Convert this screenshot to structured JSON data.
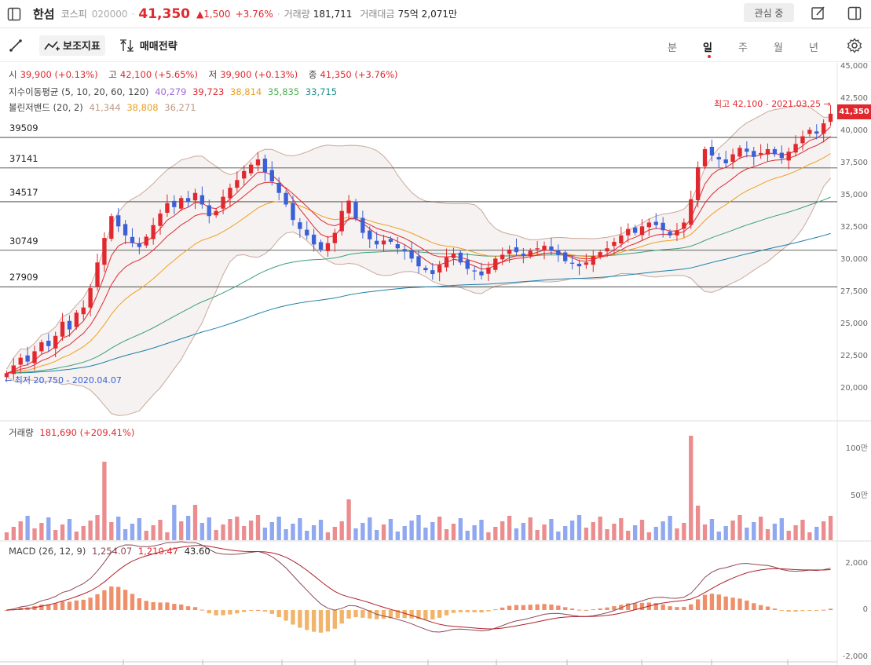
{
  "header": {
    "stock_name": "한섬",
    "market": "코스피",
    "code": "020000",
    "price": "41,350",
    "change": "▲1,500",
    "change_pct": "+3.76%",
    "volume_label": "거래량",
    "volume": "181,711",
    "amount_label": "거래대금",
    "amount": "75억 2,071만",
    "watch_label": "관심 중"
  },
  "toolbar": {
    "indicator_label": "보조지표",
    "strategy_label": "매매전략",
    "periods": [
      "분",
      "일",
      "주",
      "월",
      "년"
    ],
    "active_period": "일"
  },
  "legend": {
    "ohlc": {
      "open_label": "시",
      "open": "39,900 (+0.13%)",
      "high_label": "고",
      "high": "42,100 (+5.65%)",
      "low_label": "저",
      "low": "39,900 (+0.13%)",
      "close_label": "종",
      "close": "41,350 (+3.76%)"
    },
    "ema": {
      "label": "지수이동평균 (5, 10, 20, 60, 120)",
      "values": [
        "40,279",
        "39,723",
        "38,814",
        "35,835",
        "33,715"
      ]
    },
    "bollinger": {
      "label": "볼린저밴드 (20, 2)",
      "values": [
        "41,344",
        "38,808",
        "36,271"
      ]
    }
  },
  "horizontal_lines": [
    "39509",
    "37141",
    "34517",
    "30749",
    "27909"
  ],
  "annotations": {
    "high": "최고 42,100 - 2021.03.25 →",
    "low": "← 최저 20,750 - 2020.04.07",
    "current_price_tag": "41,350"
  },
  "volume_panel": {
    "label": "거래량",
    "value": "181,690 (+209.41%)",
    "axis": [
      "100만",
      "50만"
    ]
  },
  "macd_panel": {
    "label": "MACD (26, 12, 9)",
    "values": [
      "1,254.07",
      "1,210.47",
      "43.60"
    ],
    "axis": [
      "2,000",
      "0",
      "-2,000"
    ]
  },
  "colors": {
    "up": "#e0282e",
    "down": "#3b5fd6",
    "ema5": "#e0282e",
    "ema10": "#f0a020",
    "ema20": "#4caf50",
    "ema60": "#3aa07a",
    "ema120": "#1e7ea8",
    "bollinger_band": "#c9a99a"
  },
  "chart_data": {
    "type": "candlestick",
    "price_axis": [
      "45,000",
      "42,500",
      "40,000",
      "37,500",
      "35,000",
      "32,500",
      "30,000",
      "27,500",
      "25,000",
      "22,500",
      "20,000"
    ],
    "ylim": [
      18000,
      45000
    ],
    "close_series": [
      21200,
      21800,
      22400,
      22100,
      22900,
      23600,
      23300,
      24100,
      25200,
      24600,
      25900,
      26300,
      27800,
      29800,
      31700,
      33400,
      32600,
      31900,
      31300,
      31000,
      31800,
      32700,
      33600,
      34400,
      34100,
      34800,
      34500,
      35200,
      34300,
      33400,
      33800,
      34900,
      35600,
      36200,
      36900,
      37400,
      37800,
      36800,
      36100,
      35200,
      34300,
      33100,
      32400,
      31900,
      31200,
      30800,
      31300,
      32100,
      33800,
      34600,
      33200,
      32100,
      31600,
      31200,
      31500,
      31400,
      30900,
      30700,
      30100,
      29500,
      29200,
      28900,
      29600,
      30200,
      30500,
      29800,
      29300,
      29100,
      28800,
      29400,
      30100,
      30400,
      30800,
      30600,
      30300,
      30700,
      30900,
      31100,
      30700,
      30400,
      29900,
      29700,
      29500,
      29800,
      30300,
      30600,
      30900,
      31400,
      31900,
      32400,
      32100,
      32600,
      32900,
      32700,
      32300,
      31900,
      32300,
      32900,
      34700,
      37200,
      38600,
      38100,
      37800,
      37500,
      38200,
      38700,
      38400,
      38000,
      38300,
      38600,
      38200,
      37900,
      38400,
      39000,
      39600,
      40100,
      39800,
      40600,
      41350
    ]
  }
}
